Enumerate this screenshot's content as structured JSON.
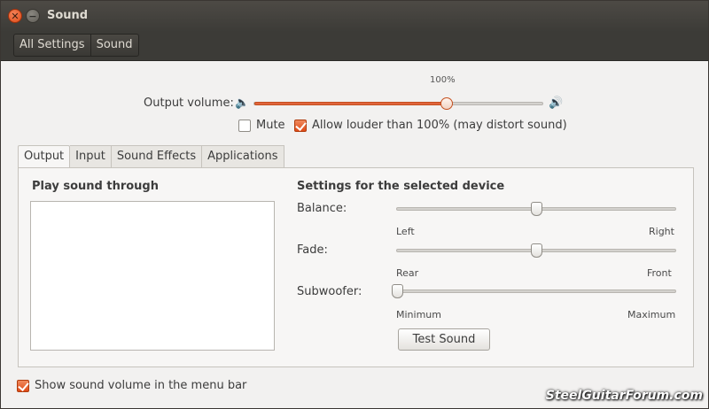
{
  "window": {
    "title": "Sound"
  },
  "toolbar": {
    "breadcrumbs": [
      "All Settings",
      "Sound"
    ]
  },
  "volume": {
    "label": "Output volume:",
    "level_label": "100%",
    "value_percent": 100,
    "max_percent": 150,
    "mute_label": "Mute",
    "mute_checked": false,
    "allow_louder_label": "Allow louder than 100% (may distort sound)",
    "allow_louder_checked": true
  },
  "tabs": [
    {
      "label": "Output",
      "active": true
    },
    {
      "label": "Input",
      "active": false
    },
    {
      "label": "Sound Effects",
      "active": false
    },
    {
      "label": "Applications",
      "active": false
    }
  ],
  "output": {
    "play_through_heading": "Play sound through",
    "devices": [],
    "settings_heading": "Settings for the selected device",
    "balance": {
      "label": "Balance:",
      "min_label": "Left",
      "max_label": "Right",
      "value": 0.5
    },
    "fade": {
      "label": "Fade:",
      "min_label": "Rear",
      "max_label": "Front",
      "value": 0.5
    },
    "subwoofer": {
      "label": "Subwoofer:",
      "min_label": "Minimum",
      "max_label": "Maximum",
      "value": 0.0
    },
    "test_button": "Test Sound"
  },
  "footer": {
    "show_volume_label": "Show sound volume in the menu bar",
    "show_volume_checked": true
  },
  "watermark": "SteelGuitarForum.com",
  "colors": {
    "accent": "#df4a16",
    "titlebar": "#3c3b37"
  }
}
